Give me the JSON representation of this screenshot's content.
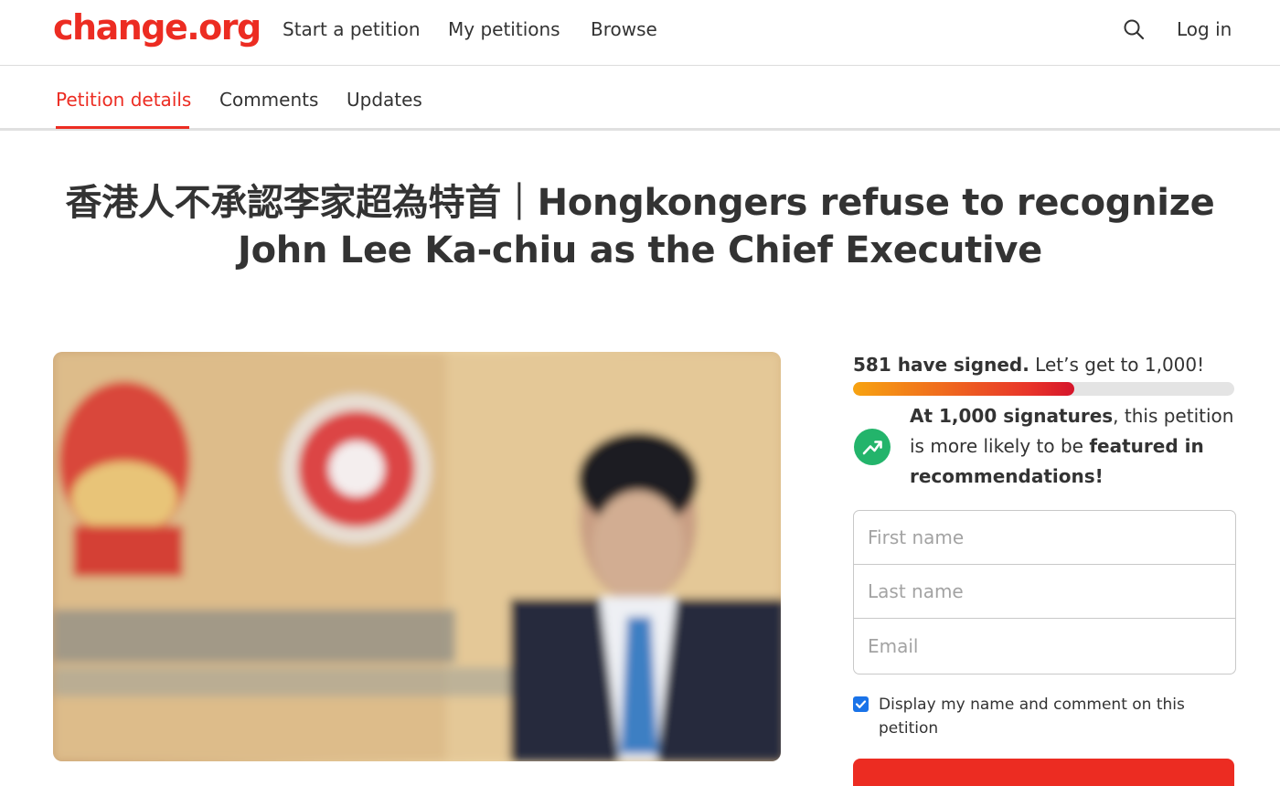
{
  "header": {
    "logo": "change.org",
    "nav": [
      "Start a petition",
      "My petitions",
      "Browse"
    ],
    "login": "Log in"
  },
  "tabs": [
    "Petition details",
    "Comments",
    "Updates"
  ],
  "petition": {
    "title_line1": "香港人不承認李家超為特首｜Hongkongers refuse to recognize",
    "title_line2": "John Lee Ka-chiu as the Chief Executive"
  },
  "signing": {
    "count_text": "581 have signed.",
    "goal_text": "Let’s get to 1,000!",
    "progress_fraction": 0.581,
    "milestone_bold": "At 1,000 signatures",
    "milestone_middle": ", this petition is more likely to be ",
    "milestone_bold2": "featured in recommendations!",
    "first_name_placeholder": "First name",
    "last_name_placeholder": "Last name",
    "email_placeholder": "Email",
    "display_checkbox_checked": true,
    "display_label": "Display my name and comment on this petition"
  },
  "icons": {
    "search": "search-icon",
    "trend": "trending-up-icon",
    "checkbox": "checkbox-checked-icon"
  },
  "colors": {
    "brand_red": "#ec2c22",
    "active_tab": "#ec2c22",
    "trend_green": "#23b46b",
    "checkbox_blue": "#1a73e8",
    "progress_start": "#f7a311",
    "progress_end": "#d5152b"
  }
}
